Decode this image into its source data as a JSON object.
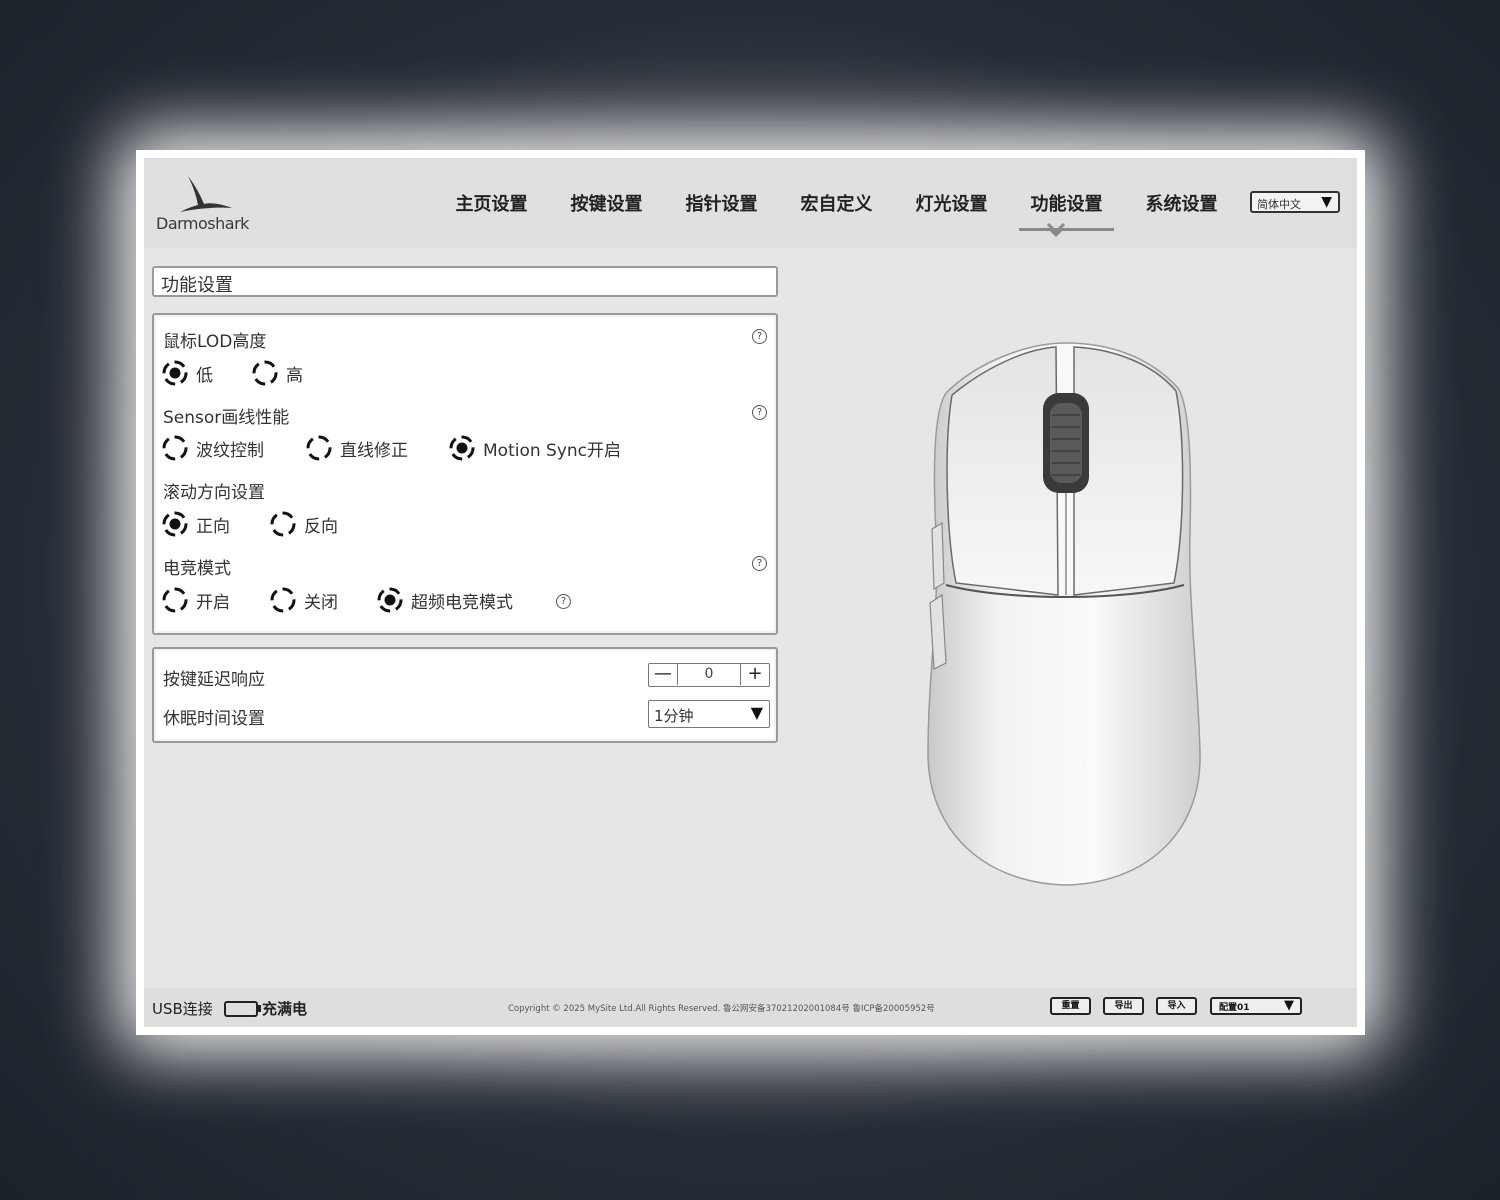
{
  "brand": {
    "name": "Darmoshark"
  },
  "nav": {
    "items": [
      {
        "label": "主页设置"
      },
      {
        "label": "按键设置"
      },
      {
        "label": "指针设置"
      },
      {
        "label": "宏自定义"
      },
      {
        "label": "灯光设置"
      },
      {
        "label": "功能设置",
        "active": true
      },
      {
        "label": "系统设置"
      }
    ],
    "language": "简体中文"
  },
  "page": {
    "title": "功能设置"
  },
  "settings": {
    "lod": {
      "label": "鼠标LOD高度",
      "options": [
        "低",
        "高"
      ],
      "selected": "低"
    },
    "sensor": {
      "label": "Sensor画线性能",
      "options": [
        "波纹控制",
        "直线修正",
        "Motion Sync开启"
      ],
      "selected": "Motion Sync开启"
    },
    "scroll": {
      "label": "滚动方向设置",
      "options": [
        "正向",
        "反向"
      ],
      "selected": "正向"
    },
    "esports": {
      "label": "电竞模式",
      "options": [
        "开启",
        "关闭",
        "超频电竞模式"
      ],
      "selected": "超频电竞模式"
    }
  },
  "keys": {
    "delay": {
      "label": "按键延迟响应",
      "value": "0",
      "minus": "—",
      "plus": "+"
    },
    "sleep": {
      "label": "休眠时间设置",
      "value": "1分钟"
    }
  },
  "footer": {
    "connection": "USB连接",
    "battery": "充满电",
    "copyright": "Copyright © 2025 MySite Ltd.All Rights Reserved. 鲁公网安备37021202001084号 鲁ICP备20005952号",
    "buttons": [
      "重置",
      "导出",
      "导入"
    ],
    "profile": "配置01"
  },
  "icons": {
    "help": "question-circle-icon",
    "dropdown": "triangle-down-icon",
    "battery": "battery-icon",
    "logo": "shark-fin-icon"
  },
  "colors": {
    "background": "#e6e6e6",
    "accent": "#222222"
  }
}
